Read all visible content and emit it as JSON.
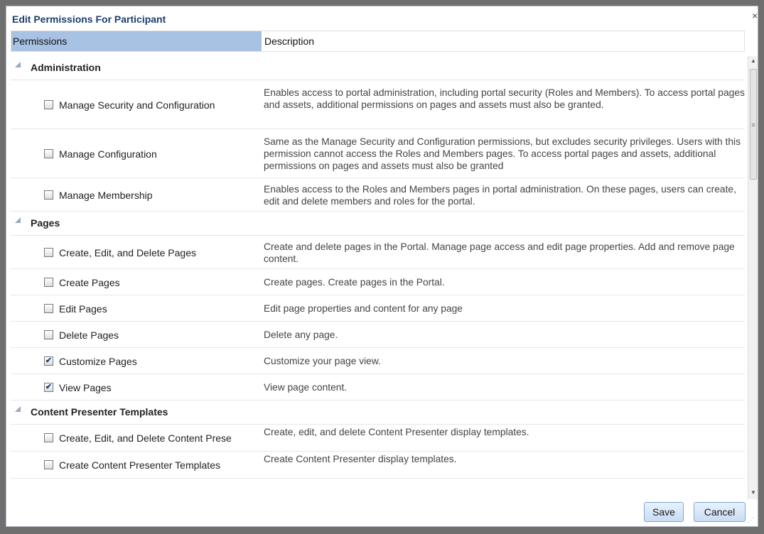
{
  "dialog": {
    "title": "Edit Permissions For Participant",
    "close_glyph": "×"
  },
  "columns": {
    "permissions": "Permissions",
    "description": "Description"
  },
  "groups": [
    {
      "title": "Administration",
      "items": [
        {
          "label": "Manage Security and Configuration",
          "checked": false,
          "description": "Enables access to portal administration, including portal security (Roles and Members). To access portal pages and assets, additional permissions on pages and assets must also be granted."
        },
        {
          "label": "Manage Configuration",
          "checked": false,
          "description": "Same as the Manage Security and Configuration permissions, but excludes security privileges. Users with this permission cannot access the Roles and Members pages. To access portal pages and assets, additional permissions on pages and assets must also be granted"
        },
        {
          "label": "Manage Membership",
          "checked": false,
          "description": "Enables access to the Roles and Members pages in portal administration. On these pages, users can create, edit and delete members and roles for the portal."
        }
      ]
    },
    {
      "title": "Pages",
      "items": [
        {
          "label": "Create, Edit, and Delete Pages",
          "checked": false,
          "description": "Create and delete pages in the Portal. Manage page access and edit page properties. Add and remove page content."
        },
        {
          "label": "Create Pages",
          "checked": false,
          "description": "Create pages. Create pages in the Portal."
        },
        {
          "label": "Edit Pages",
          "checked": false,
          "description": "Edit page properties and content for any page"
        },
        {
          "label": "Delete Pages",
          "checked": false,
          "description": "Delete any page."
        },
        {
          "label": "Customize Pages",
          "checked": true,
          "description": "Customize your page view."
        },
        {
          "label": "View Pages",
          "checked": true,
          "description": "View page content."
        }
      ]
    },
    {
      "title": "Content Presenter Templates",
      "items": [
        {
          "label": "Create, Edit, and Delete Content Prese",
          "checked": false,
          "description": "Create, edit, and delete Content Presenter display templates."
        },
        {
          "label": "Create Content Presenter Templates",
          "checked": false,
          "description": "Create Content Presenter display templates."
        }
      ]
    }
  ],
  "buttons": {
    "save": "Save",
    "cancel": "Cancel"
  },
  "colors": {
    "title_text": "#1c3d73",
    "header_highlight": "#a8c2e3",
    "button_border": "#7ea7d8"
  }
}
